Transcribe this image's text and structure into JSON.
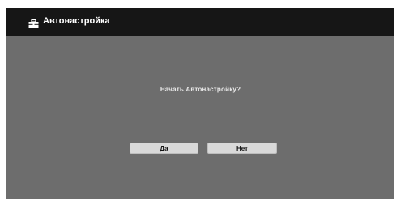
{
  "dialog": {
    "title": "Автонастройка",
    "title_icon": "toolbox-icon",
    "question": "Начать Автонастройку?",
    "buttons": {
      "yes_label": "Да",
      "no_label": "Нет"
    }
  },
  "colors": {
    "titlebar": "#161616",
    "background": "#6d6d6d",
    "button": "#d9d9d9",
    "title_text": "#ffffff"
  }
}
